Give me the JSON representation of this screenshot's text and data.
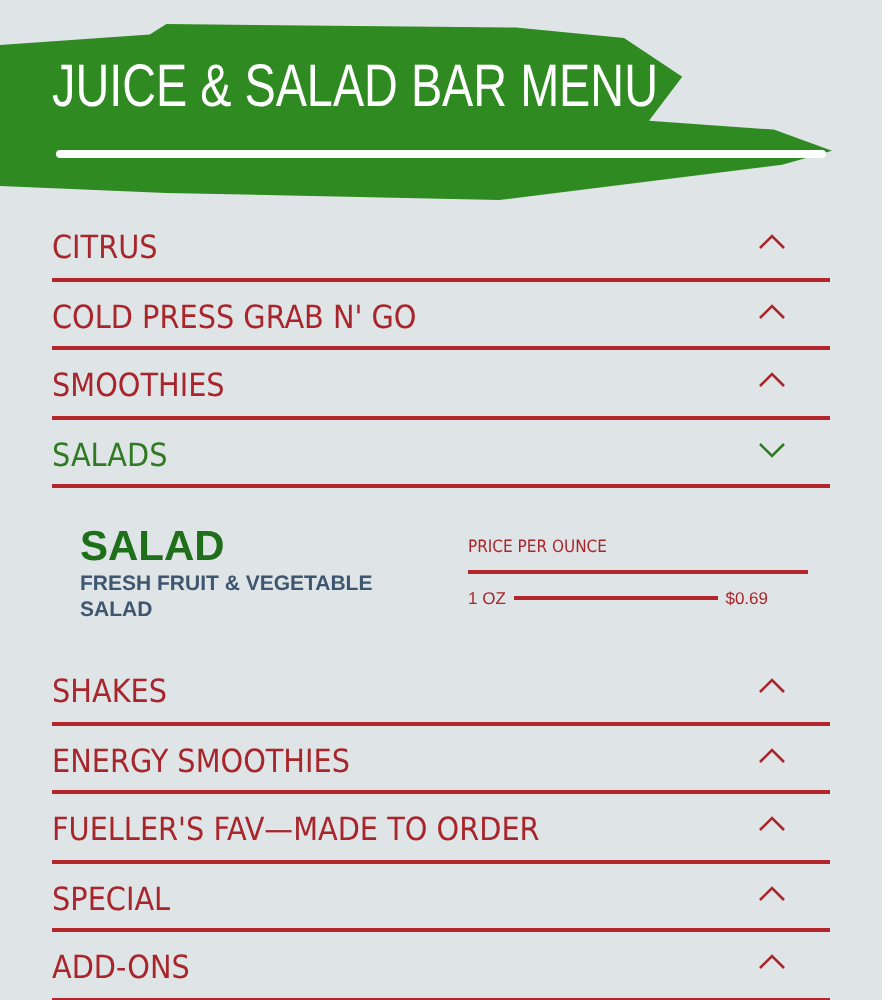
{
  "header": {
    "title": "JUICE & SALAD BAR MENU"
  },
  "sections": [
    {
      "label": "CITRUS",
      "expanded": false
    },
    {
      "label": "COLD PRESS GRAB N' GO",
      "expanded": false
    },
    {
      "label": "SMOOTHIES",
      "expanded": false
    },
    {
      "label": "SALADS",
      "expanded": true,
      "items": [
        {
          "name": "SALAD",
          "description": "FRESH FRUIT & VEGETABLE SALAD",
          "price_heading": "PRICE PER OUNCE",
          "prices": [
            {
              "size": "1 OZ",
              "price": "$0.69"
            }
          ]
        }
      ]
    },
    {
      "label": "SHAKES",
      "expanded": false
    },
    {
      "label": "ENERGY SMOOTHIES",
      "expanded": false
    },
    {
      "label": "FUELLER'S FAV—MADE TO ORDER",
      "expanded": false
    },
    {
      "label": "SPECIAL",
      "expanded": false
    },
    {
      "label": "ADD-ONS",
      "expanded": false
    }
  ]
}
